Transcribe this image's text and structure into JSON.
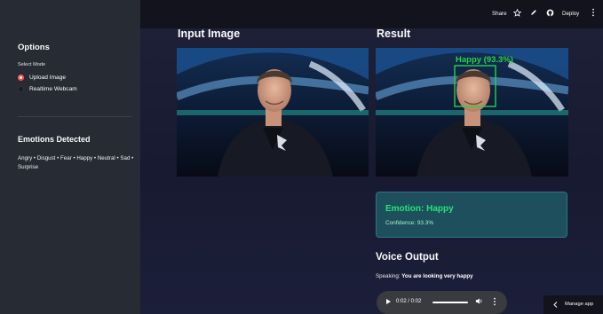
{
  "sidebar": {
    "options_title": "Options",
    "mode_label": "Select Mode",
    "modes": [
      {
        "label": "Upload Image",
        "selected": true
      },
      {
        "label": "Realtime Webcam",
        "selected": false
      }
    ],
    "emotions_title": "Emotions Detected",
    "emotions_list": "Angry • Disgust • Fear • Happy • Neutral • Sad • Surprise"
  },
  "toolbar": {
    "share_label": "Share",
    "deploy_label": "Deploy"
  },
  "main": {
    "input_title": "Input Image",
    "result_title": "Result",
    "detection_label": "Happy (93.3%)",
    "emotion_result": "Emotion: Happy",
    "confidence": "Confidence: 93.3%",
    "voice_title": "Voice Output",
    "speaking_prefix": "Speaking:",
    "speaking_text": "You are looking very happy"
  },
  "audio": {
    "time": "0:02 / 0:02",
    "progress": 1.0
  },
  "manage_label": "Manage app",
  "colors": {
    "accent_red": "#ff4b4b",
    "emotion_green": "#26e37a",
    "box_green": "#22d44a"
  }
}
